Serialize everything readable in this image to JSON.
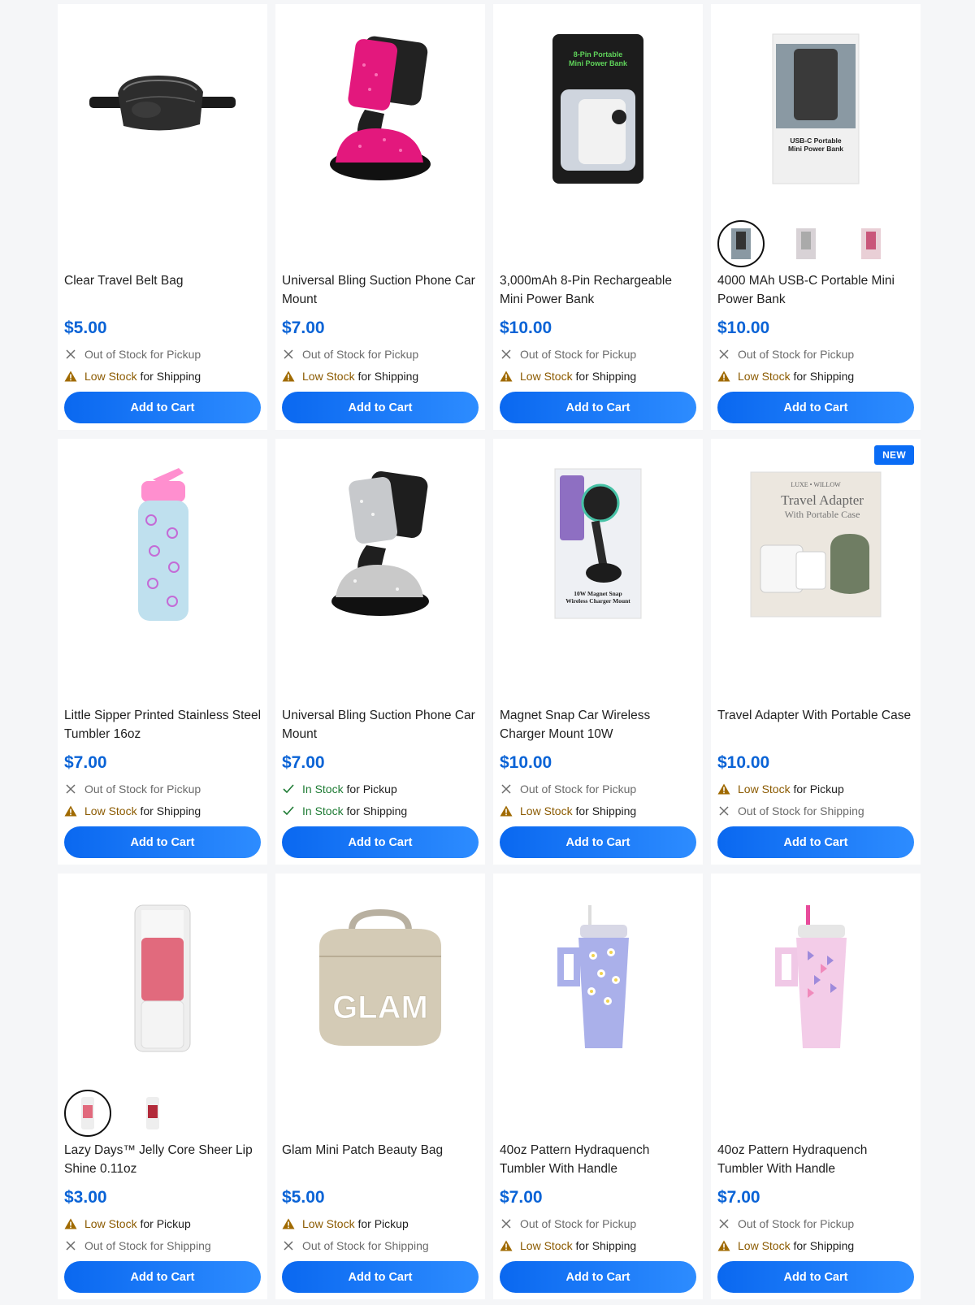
{
  "colors": {
    "accent": "#0a6cf5",
    "price": "#0a63d6",
    "low": "#8b5a00",
    "in": "#1e7b34"
  },
  "products": [
    {
      "title": "Clear Travel Belt Bag",
      "price": "$5.00",
      "image": "belt-bag-image",
      "a1": {
        "icon": "x-icon",
        "status": "Out of Stock",
        "suffix": " for Pickup",
        "kind": "out"
      },
      "a2": {
        "icon": "warning-icon",
        "status": "Low Stock",
        "suffix": " for Shipping",
        "kind": "low"
      },
      "cta": "Add to Cart"
    },
    {
      "title": "Universal Bling Suction Phone Car Mount",
      "price": "$7.00",
      "image": "pink-phone-mount-image",
      "a1": {
        "icon": "x-icon",
        "status": "Out of Stock",
        "suffix": " for Pickup",
        "kind": "out"
      },
      "a2": {
        "icon": "warning-icon",
        "status": "Low Stock",
        "suffix": " for Shipping",
        "kind": "low"
      },
      "cta": "Add to Cart"
    },
    {
      "title": "3,000mAh 8-Pin Rechargeable Mini Power Bank",
      "price": "$10.00",
      "image": "power-bank-package-image",
      "a1": {
        "icon": "x-icon",
        "status": "Out of Stock",
        "suffix": " for Pickup",
        "kind": "out"
      },
      "a2": {
        "icon": "warning-icon",
        "status": "Low Stock",
        "suffix": " for Shipping",
        "kind": "low"
      },
      "cta": "Add to Cart"
    },
    {
      "title": "4000 MAh USB-C Portable Mini Power Bank",
      "price": "$10.00",
      "image": "usbc-power-bank-image",
      "swatches": [
        "black",
        "silver",
        "pink"
      ],
      "a1": {
        "icon": "x-icon",
        "status": "Out of Stock",
        "suffix": " for Pickup",
        "kind": "out"
      },
      "a2": {
        "icon": "warning-icon",
        "status": "Low Stock",
        "suffix": " for Shipping",
        "kind": "low"
      },
      "cta": "Add to Cart"
    },
    {
      "title": "Little Sipper Printed Stainless Steel Tumbler 16oz",
      "price": "$7.00",
      "image": "heart-tumbler-image",
      "a1": {
        "icon": "x-icon",
        "status": "Out of Stock",
        "suffix": " for Pickup",
        "kind": "out"
      },
      "a2": {
        "icon": "warning-icon",
        "status": "Low Stock",
        "suffix": " for Shipping",
        "kind": "low"
      },
      "cta": "Add to Cart"
    },
    {
      "title": "Universal Bling Suction Phone Car Mount",
      "price": "$7.00",
      "image": "silver-phone-mount-image",
      "a1": {
        "icon": "check-icon",
        "status": "In Stock",
        "suffix": " for Pickup",
        "kind": "in"
      },
      "a2": {
        "icon": "check-icon",
        "status": "In Stock",
        "suffix": " for Shipping",
        "kind": "in"
      },
      "cta": "Add to Cart"
    },
    {
      "title": "Magnet Snap Car Wireless Charger Mount 10W",
      "price": "$10.00",
      "image": "magnet-charger-image",
      "a1": {
        "icon": "x-icon",
        "status": "Out of Stock",
        "suffix": " for Pickup",
        "kind": "out"
      },
      "a2": {
        "icon": "warning-icon",
        "status": "Low Stock",
        "suffix": " for Shipping",
        "kind": "low"
      },
      "cta": "Add to Cart"
    },
    {
      "title": "Travel Adapter With Portable Case",
      "price": "$10.00",
      "image": "travel-adapter-image",
      "badge": "NEW",
      "a1": {
        "icon": "warning-icon",
        "status": "Low Stock",
        "suffix": " for Pickup",
        "kind": "low"
      },
      "a2": {
        "icon": "x-icon",
        "status": "Out of Stock",
        "suffix": " for Shipping",
        "kind": "out"
      },
      "cta": "Add to Cart"
    },
    {
      "title": "Lazy Days™ Jelly Core Sheer Lip Shine 0.11oz",
      "price": "$3.00",
      "image": "lip-shine-image",
      "swatches": [
        "pink",
        "red"
      ],
      "a1": {
        "icon": "warning-icon",
        "status": "Low Stock",
        "suffix": " for Pickup",
        "kind": "low"
      },
      "a2": {
        "icon": "x-icon",
        "status": "Out of Stock",
        "suffix": " for Shipping",
        "kind": "out"
      },
      "cta": "Add to Cart"
    },
    {
      "title": "Glam Mini Patch Beauty Bag",
      "price": "$5.00",
      "image": "glam-bag-image",
      "a1": {
        "icon": "warning-icon",
        "status": "Low Stock",
        "suffix": " for Pickup",
        "kind": "low"
      },
      "a2": {
        "icon": "x-icon",
        "status": "Out of Stock",
        "suffix": " for Shipping",
        "kind": "out"
      },
      "cta": "Add to Cart"
    },
    {
      "title": "40oz Pattern Hydraquench Tumbler With Handle",
      "price": "$7.00",
      "image": "daisy-tumbler-image",
      "a1": {
        "icon": "x-icon",
        "status": "Out of Stock",
        "suffix": " for Pickup",
        "kind": "out"
      },
      "a2": {
        "icon": "warning-icon",
        "status": "Low Stock",
        "suffix": " for Shipping",
        "kind": "low"
      },
      "cta": "Add to Cart"
    },
    {
      "title": "40oz Pattern Hydraquench Tumbler With Handle",
      "price": "$7.00",
      "image": "butterfly-tumbler-image",
      "a1": {
        "icon": "x-icon",
        "status": "Out of Stock",
        "suffix": " for Pickup",
        "kind": "out"
      },
      "a2": {
        "icon": "warning-icon",
        "status": "Low Stock",
        "suffix": " for Shipping",
        "kind": "low"
      },
      "cta": "Add to Cart"
    }
  ],
  "image_text": {
    "power_bank": [
      "8-Pin Portable",
      "Mini Power Bank"
    ],
    "usbc": [
      "USB-C Portable",
      "Mini Power Bank"
    ],
    "charger": [
      "10W Magnet Snap",
      "Wireless Charger Mount"
    ],
    "adapter": [
      "LUXE • WILLOW",
      "Travel Adapter",
      "With Portable Case"
    ],
    "glam": "GLAM"
  }
}
